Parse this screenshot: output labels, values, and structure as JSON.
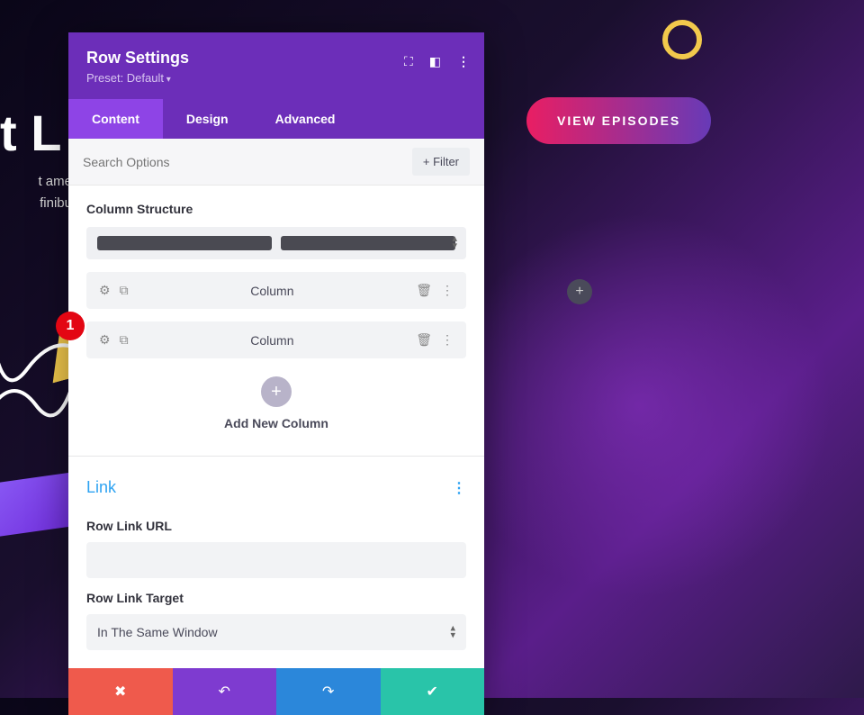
{
  "background": {
    "heading_fragment": "t L",
    "paragraph_line1": "t amet, c",
    "paragraph_line2": "finibus e",
    "view_button": "VIEW EPISODES"
  },
  "modal": {
    "title": "Row Settings",
    "preset": "Preset: Default",
    "tabs": {
      "content": "Content",
      "design": "Design",
      "advanced": "Advanced"
    },
    "search_placeholder": "Search Options",
    "filter_label": "+ Filter",
    "column_structure_label": "Column Structure",
    "columns": [
      "Column",
      "Column"
    ],
    "add_column_label": "Add New Column",
    "link_section": "Link",
    "row_link_url_label": "Row Link URL",
    "row_link_url_value": "",
    "row_link_target_label": "Row Link Target",
    "row_link_target_value": "In The Same Window"
  },
  "marker": "1"
}
